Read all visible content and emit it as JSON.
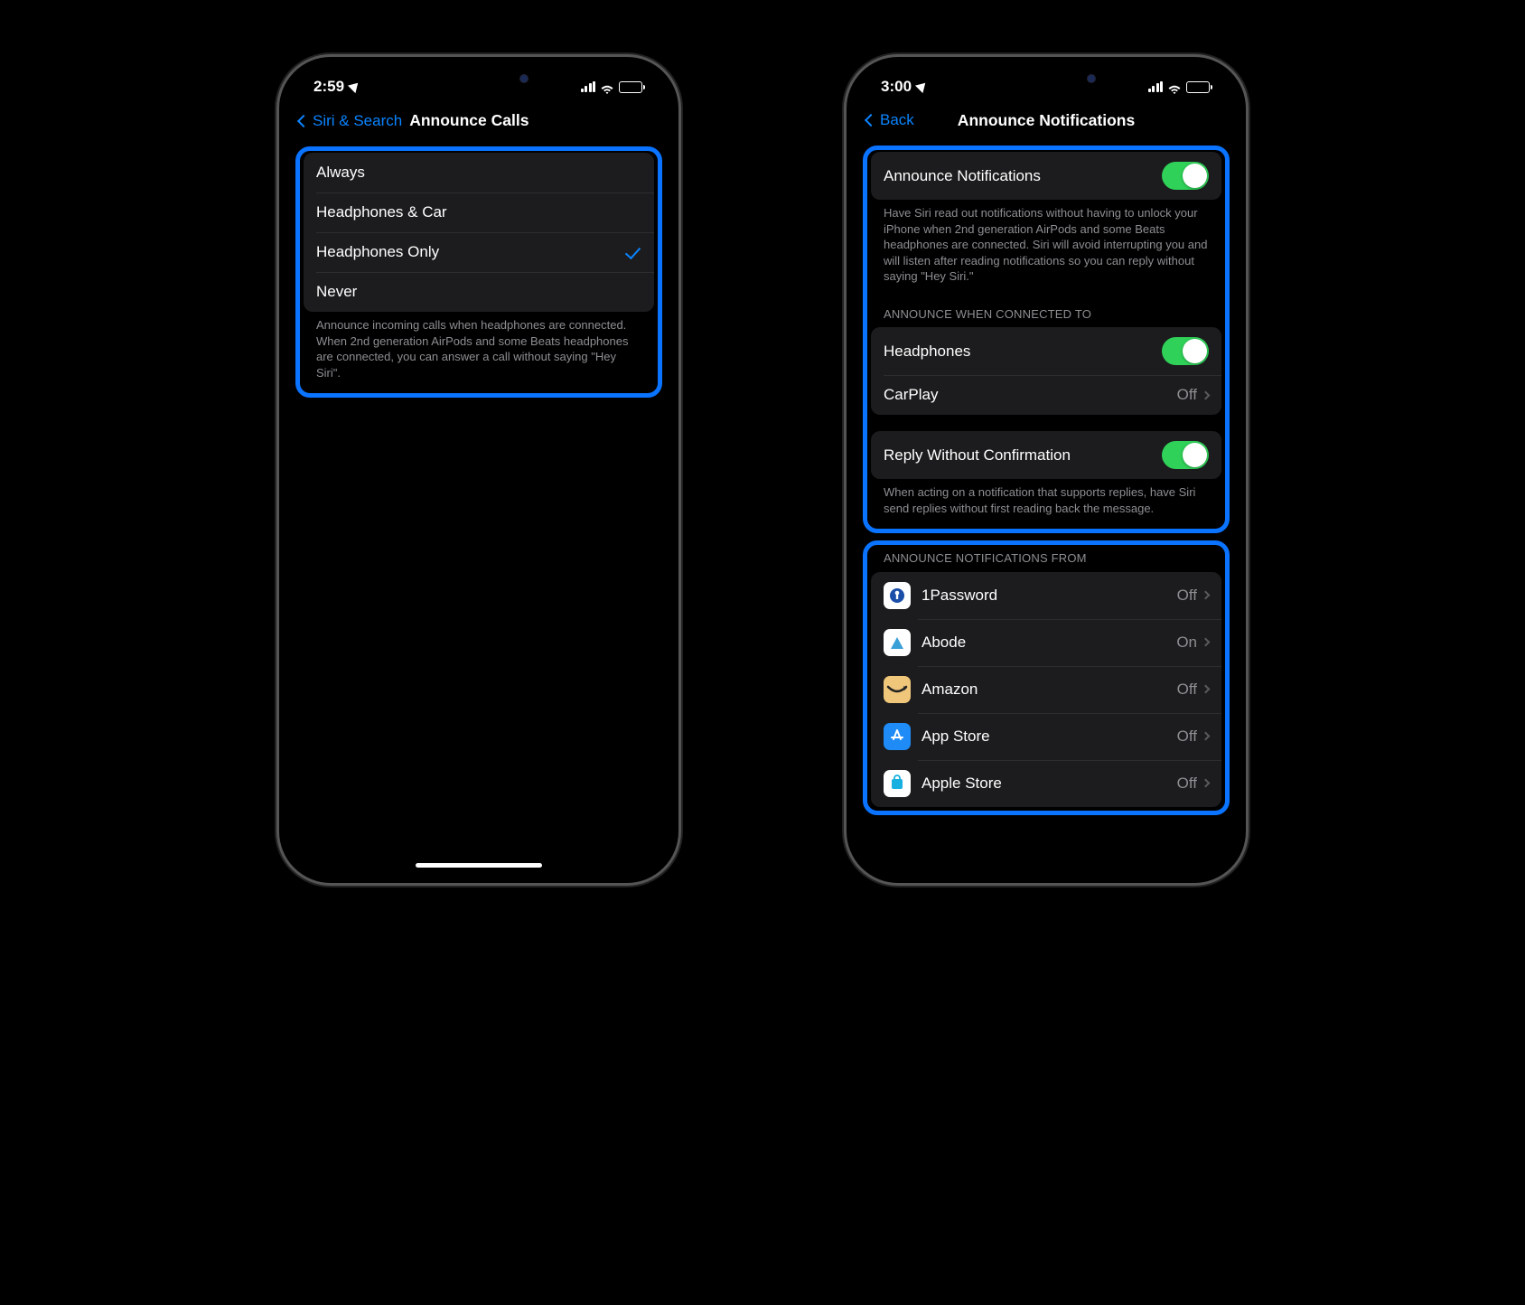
{
  "left": {
    "status": {
      "time": "2:59"
    },
    "nav": {
      "back": "Siri & Search",
      "title": "Announce Calls"
    },
    "options": [
      {
        "label": "Always"
      },
      {
        "label": "Headphones & Car"
      },
      {
        "label": "Headphones Only",
        "selected": true
      },
      {
        "label": "Never"
      }
    ],
    "footer": "Announce incoming calls when headphones are connected. When 2nd generation AirPods and some Beats headphones are connected, you can answer a call without saying \"Hey Siri\"."
  },
  "right": {
    "status": {
      "time": "3:00"
    },
    "nav": {
      "back": "Back",
      "title": "Announce Notifications"
    },
    "main_toggle": {
      "label": "Announce Notifications",
      "on": true
    },
    "main_footer": "Have Siri read out notifications without having to unlock your iPhone when 2nd generation AirPods and some Beats headphones are connected. Siri will avoid interrupting you and will listen after reading notifications so you can reply without saying \"Hey Siri.\"",
    "connected_header": "ANNOUNCE WHEN CONNECTED TO",
    "connected": [
      {
        "label": "Headphones",
        "type": "toggle",
        "on": true
      },
      {
        "label": "CarPlay",
        "type": "detail",
        "value": "Off"
      }
    ],
    "reply": {
      "label": "Reply Without Confirmation",
      "on": true
    },
    "reply_footer": "When acting on a notification that supports replies, have Siri send replies without first reading back the message.",
    "apps_header": "ANNOUNCE NOTIFICATIONS FROM",
    "apps": [
      {
        "name": "1Password",
        "value": "Off",
        "icon": "1password"
      },
      {
        "name": "Abode",
        "value": "On",
        "icon": "abode"
      },
      {
        "name": "Amazon",
        "value": "Off",
        "icon": "amazon"
      },
      {
        "name": "App Store",
        "value": "Off",
        "icon": "appstore"
      },
      {
        "name": "Apple Store",
        "value": "Off",
        "icon": "applestore"
      }
    ]
  }
}
